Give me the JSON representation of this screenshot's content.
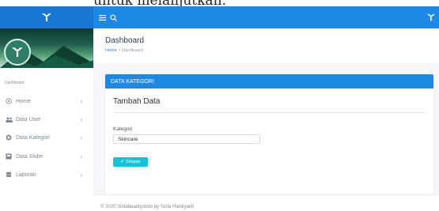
{
  "caption": {
    "text": "untuk melanjutkan."
  },
  "topbar": {
    "menu_icon": "hamburger-icon",
    "search_icon": "search-icon",
    "brand_color": "#1e88e5"
  },
  "sidebar": {
    "header": "Dashboard",
    "items": [
      {
        "label": "Home",
        "icon": "home-icon"
      },
      {
        "label": "Data User",
        "icon": "users-icon"
      },
      {
        "label": "Data Kategori",
        "icon": "tag-icon"
      },
      {
        "label": "Data Slider",
        "icon": "image-icon"
      },
      {
        "label": "Laporan",
        "icon": "report-icon"
      }
    ]
  },
  "page": {
    "title": "Dashboard",
    "breadcrumb_home": "Home",
    "breadcrumb_sep": ">",
    "breadcrumb_current": "Dashboard"
  },
  "card": {
    "header": "DATA KATEGORI",
    "subtitle": "Tambah Data",
    "field_label": "Kategori",
    "field_value": "Skincare",
    "save_label": "Simpan"
  },
  "footer": {
    "text": "© 2020 Sintabeautystore by Sinta Hardiyanti"
  },
  "colors": {
    "accent": "#1e88e5",
    "button": "#17c2d8"
  }
}
